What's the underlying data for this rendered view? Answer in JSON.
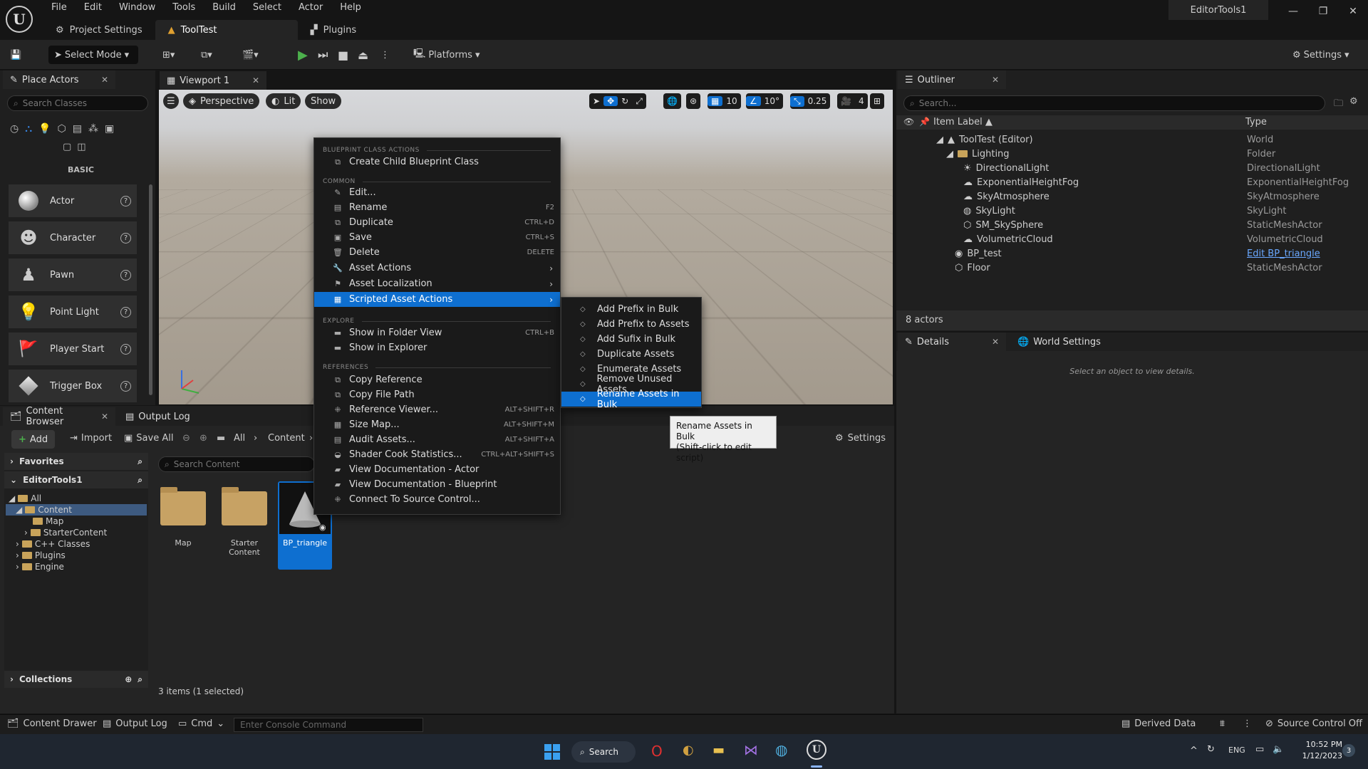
{
  "app": {
    "project_name": "EditorTools1"
  },
  "menu": [
    "File",
    "Edit",
    "Window",
    "Tools",
    "Build",
    "Select",
    "Actor",
    "Help"
  ],
  "doc_tabs": [
    {
      "label": "Project Settings"
    },
    {
      "label": "ToolTest"
    },
    {
      "label": "Plugins"
    }
  ],
  "toolbar": {
    "select_mode": "Select Mode",
    "platforms": "Platforms",
    "settings": "Settings"
  },
  "place_actors": {
    "tab": "Place Actors",
    "search_placeholder": "Search Classes",
    "category": "BASIC",
    "items": [
      "Actor",
      "Character",
      "Pawn",
      "Point Light",
      "Player Start",
      "Trigger Box"
    ]
  },
  "viewport": {
    "tab": "Viewport 1",
    "perspective": "Perspective",
    "lit": "Lit",
    "show": "Show",
    "grid_snap": "10",
    "rot_snap": "10°",
    "scale_snap": "0.25",
    "cam_speed": "4"
  },
  "context_menu": {
    "headers": [
      "BLUEPRINT CLASS ACTIONS",
      "COMMON",
      "EXPLORE",
      "REFERENCES"
    ],
    "blueprint": [
      {
        "label": "Create Child Blueprint Class",
        "shortcut": ""
      }
    ],
    "common": [
      {
        "label": "Edit...",
        "shortcut": ""
      },
      {
        "label": "Rename",
        "shortcut": "F2"
      },
      {
        "label": "Duplicate",
        "shortcut": "CTRL+D"
      },
      {
        "label": "Save",
        "shortcut": "CTRL+S"
      },
      {
        "label": "Delete",
        "shortcut": "DELETE"
      },
      {
        "label": "Asset Actions",
        "shortcut": ""
      },
      {
        "label": "Asset Localization",
        "shortcut": ""
      },
      {
        "label": "Scripted Asset Actions",
        "shortcut": ""
      }
    ],
    "explore": [
      {
        "label": "Show in Folder View",
        "shortcut": "CTRL+B"
      },
      {
        "label": "Show in Explorer",
        "shortcut": ""
      }
    ],
    "references": [
      {
        "label": "Copy Reference",
        "shortcut": ""
      },
      {
        "label": "Copy File Path",
        "shortcut": ""
      },
      {
        "label": "Reference Viewer...",
        "shortcut": "ALT+SHIFT+R"
      },
      {
        "label": "Size Map...",
        "shortcut": "ALT+SHIFT+M"
      },
      {
        "label": "Audit Assets...",
        "shortcut": "ALT+SHIFT+A"
      },
      {
        "label": "Shader Cook Statistics...",
        "shortcut": "CTRL+ALT+SHIFT+S"
      },
      {
        "label": "View Documentation - Actor",
        "shortcut": ""
      },
      {
        "label": "View Documentation - Blueprint",
        "shortcut": ""
      },
      {
        "label": "Connect To Source Control...",
        "shortcut": ""
      }
    ]
  },
  "submenu": [
    "Add Prefix in Bulk",
    "Add Prefix to Assets",
    "Add Sufix in Bulk",
    "Duplicate Assets",
    "Enumerate Assets",
    "Remove Unused Assets",
    "Rename Assets in Bulk"
  ],
  "tooltip": {
    "line1": "Rename Assets in Bulk",
    "line2": "(Shift-click to edit script)"
  },
  "outliner": {
    "tab": "Outliner",
    "search_placeholder": "Search...",
    "col_label": "Item Label ▲",
    "col_type": "Type",
    "rows": [
      {
        "label": "ToolTest (Editor)",
        "type": "World"
      },
      {
        "label": "Lighting",
        "type": "Folder"
      },
      {
        "label": "DirectionalLight",
        "type": "DirectionalLight"
      },
      {
        "label": "ExponentialHeightFog",
        "type": "ExponentialHeightFog"
      },
      {
        "label": "SkyAtmosphere",
        "type": "SkyAtmosphere"
      },
      {
        "label": "SkyLight",
        "type": "SkyLight"
      },
      {
        "label": "SM_SkySphere",
        "type": "StaticMeshActor"
      },
      {
        "label": "VolumetricCloud",
        "type": "VolumetricCloud"
      },
      {
        "label": "BP_test",
        "type": "Edit BP_triangle"
      },
      {
        "label": "Floor",
        "type": "StaticMeshActor"
      }
    ],
    "count": "8 actors"
  },
  "details": {
    "tab": "Details",
    "world_tab": "World Settings",
    "empty": "Select an object to view details."
  },
  "content_browser": {
    "tab": "Content Browser",
    "output_tab": "Output Log",
    "add": "Add",
    "import": "Import",
    "save_all": "Save All",
    "crumb_all": "All",
    "crumb_content": "Content",
    "settings": "Settings",
    "favorites": "Favorites",
    "project": "EditorTools1",
    "tree": [
      "All",
      "Content",
      "Map",
      "StarterContent",
      "C++ Classes",
      "Plugins",
      "Engine"
    ],
    "search_placeholder": "Search Content",
    "assets": [
      "Map",
      "Starter Content",
      "BP_triangle"
    ],
    "collections": "Collections",
    "status": "3 items (1 selected)"
  },
  "statusbar": {
    "content_drawer": "Content Drawer",
    "output_log": "Output Log",
    "cmd": "Cmd",
    "console_placeholder": "Enter Console Command",
    "derived": "Derived Data",
    "source_control": "Source Control Off"
  },
  "taskbar": {
    "search": "Search",
    "lang": "ENG",
    "time": "10:52 PM",
    "date": "1/12/2023",
    "badge": "3"
  }
}
